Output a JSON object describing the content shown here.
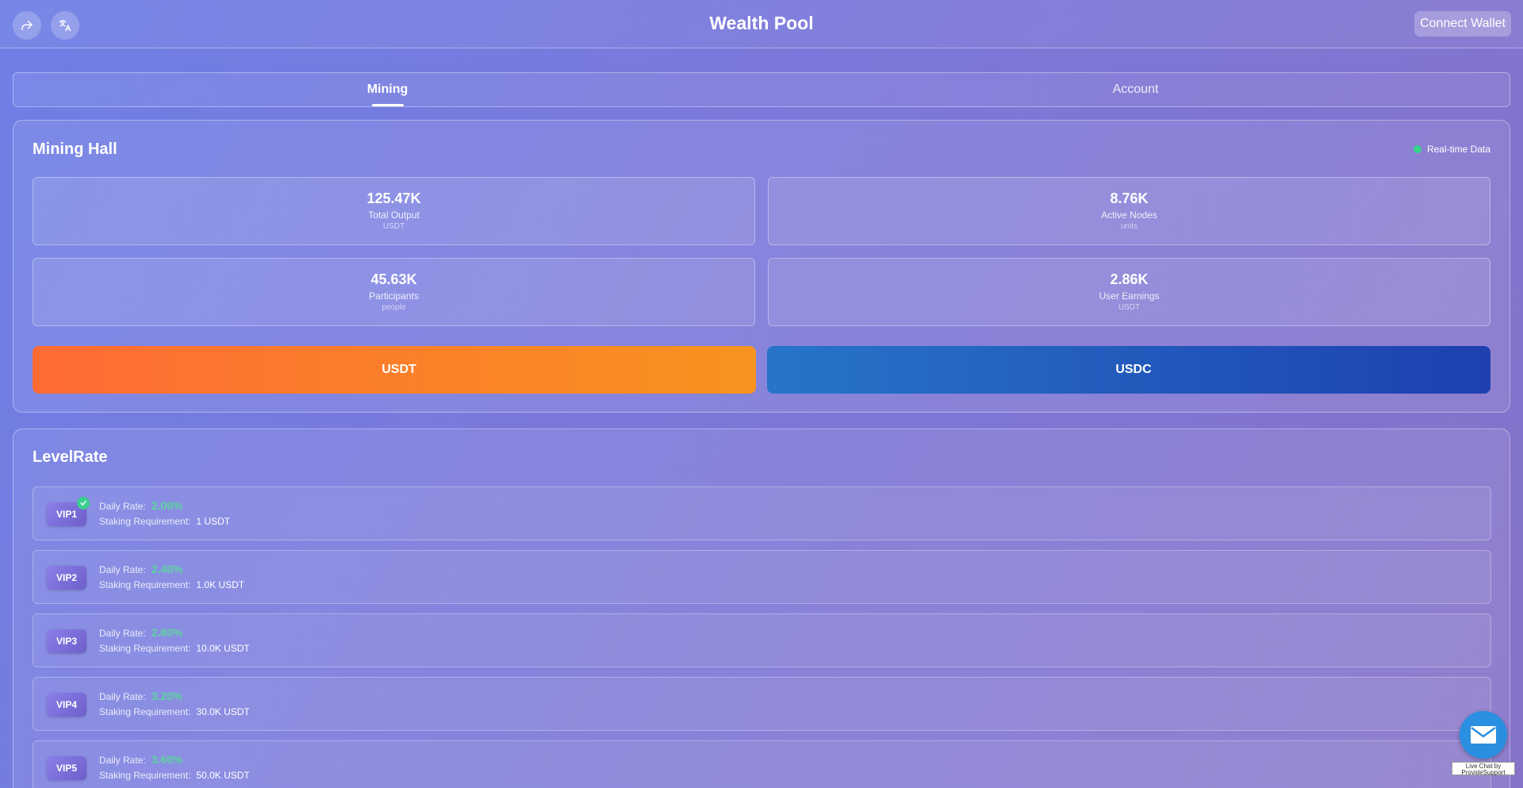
{
  "header": {
    "title": "Wealth Pool",
    "share_icon": "share-icon",
    "translate_icon": "translate-icon",
    "connect_label": "Connect Wallet"
  },
  "tabs": [
    {
      "label": "Mining",
      "active": true
    },
    {
      "label": "Account",
      "active": false
    }
  ],
  "mining_hall": {
    "title": "Mining Hall",
    "realtime_label": "Real-time Data",
    "stats": [
      {
        "value": "125.47K",
        "label": "Total Output",
        "unit": "USDT"
      },
      {
        "value": "8.76K",
        "label": "Active Nodes",
        "unit": "units"
      },
      {
        "value": "45.63K",
        "label": "Participants",
        "unit": "people"
      },
      {
        "value": "2.86K",
        "label": "User Earnings",
        "unit": "USDT"
      }
    ],
    "buttons": [
      {
        "label": "USDT",
        "glyph": "",
        "color": "#ff6b35"
      },
      {
        "label": "USDC",
        "glyph": "",
        "color": "#2775ca"
      }
    ]
  },
  "level_rate": {
    "title": "LevelRate",
    "rate_label": "Daily Rate:",
    "staking_label": "Staking Requirement:",
    "levels": [
      {
        "name": "VIP1",
        "rate": "2.00%",
        "requirement": "1 USDT",
        "current": true
      },
      {
        "name": "VIP2",
        "rate": "2.40%",
        "requirement": "1.0K USDT",
        "current": false
      },
      {
        "name": "VIP3",
        "rate": "2.80%",
        "requirement": "10.0K USDT",
        "current": false
      },
      {
        "name": "VIP4",
        "rate": "3.20%",
        "requirement": "30.0K USDT",
        "current": false
      },
      {
        "name": "VIP5",
        "rate": "3.60%",
        "requirement": "50.0K USDT",
        "current": false
      }
    ]
  },
  "chat": {
    "icon": "envelope-icon",
    "line1": "Live Chat by",
    "line2": "ProvideSupport"
  },
  "colors": {
    "accent_green": "#5dd39e",
    "status_dot": "#35d489",
    "usdt_orange": "#f7931e",
    "usdc_blue": "#1e40af"
  }
}
